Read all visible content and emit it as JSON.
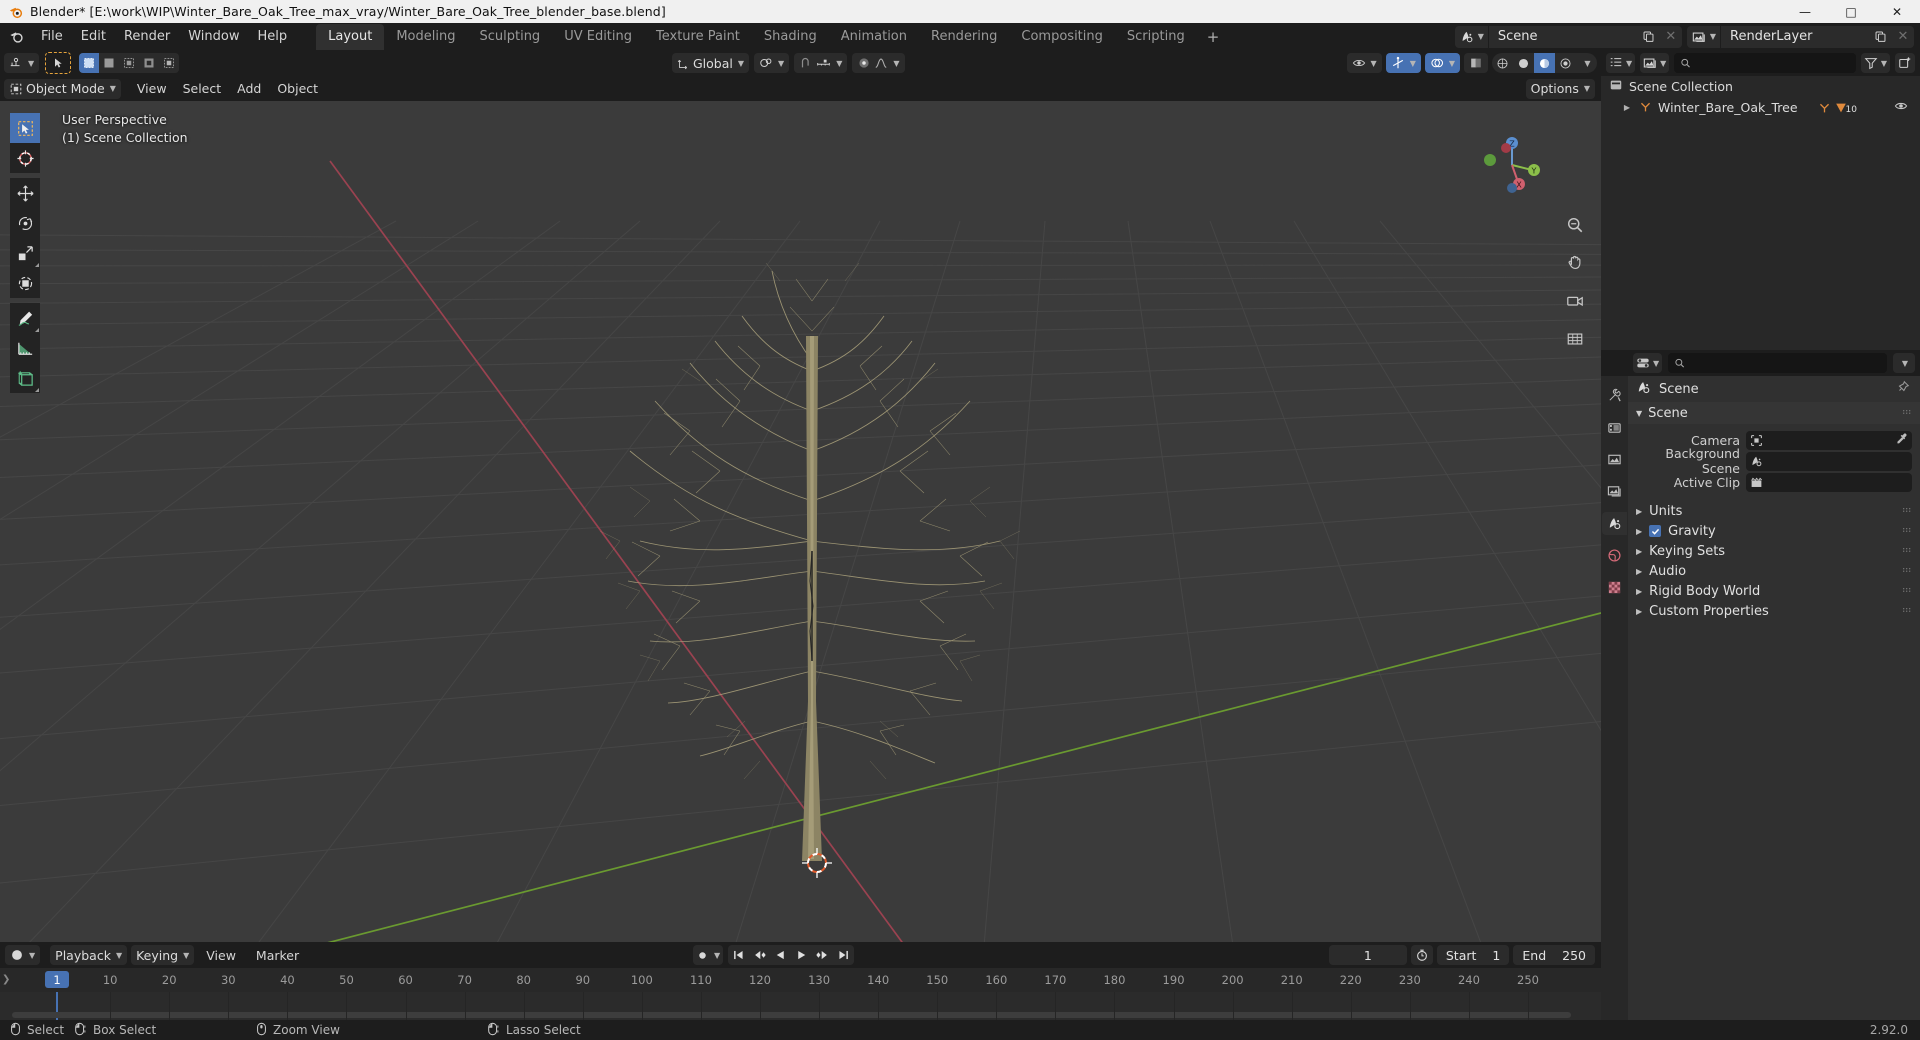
{
  "window": {
    "title": "Blender* [E:\\work\\WIP\\Winter_Bare_Oak_Tree_max_vray/Winter_Bare_Oak_Tree_blender_base.blend]",
    "minimize": "—",
    "maximize": "□",
    "close": "✕"
  },
  "topbar": {
    "menus": [
      "File",
      "Edit",
      "Render",
      "Window",
      "Help"
    ],
    "workspaces": [
      {
        "label": "Layout",
        "active": true
      },
      {
        "label": "Modeling",
        "active": false
      },
      {
        "label": "Sculpting",
        "active": false
      },
      {
        "label": "UV Editing",
        "active": false
      },
      {
        "label": "Texture Paint",
        "active": false
      },
      {
        "label": "Shading",
        "active": false
      },
      {
        "label": "Animation",
        "active": false
      },
      {
        "label": "Rendering",
        "active": false
      },
      {
        "label": "Compositing",
        "active": false
      },
      {
        "label": "Scripting",
        "active": false
      }
    ],
    "add_workspace": "+",
    "scene_name": "Scene",
    "viewlayer_name": "RenderLayer"
  },
  "viewport": {
    "header": {
      "mode": "Object Mode",
      "menus": [
        "View",
        "Select",
        "Add",
        "Object"
      ],
      "transform_orientation": "Global",
      "options_label": "Options"
    },
    "overlay": {
      "view_name": "User Perspective",
      "collection": "(1) Scene Collection"
    },
    "gizmo_axes": {
      "x": "X",
      "y": "Y",
      "z": "Z"
    },
    "tools": [
      "tweak-select-tool",
      "cursor-tool",
      "move-tool",
      "rotate-tool",
      "scale-tool",
      "transform-tool",
      "annotate-tool",
      "measure-tool",
      "add-cube-tool"
    ]
  },
  "outliner": {
    "search_placeholder": "",
    "rows": [
      {
        "label": "Scene Collection",
        "indent": 0,
        "icon": "collection-icon",
        "badge": null
      },
      {
        "label": "Winter_Bare_Oak_Tree",
        "indent": 1,
        "icon": "object-empty-icon",
        "badge": "10"
      }
    ]
  },
  "properties": {
    "search_placeholder": "",
    "breadcrumb": "Scene",
    "panel_title": "Scene",
    "fields": [
      {
        "label": "Camera",
        "value": "",
        "icon": "camera-data-icon",
        "eyedropper": true
      },
      {
        "label": "Background Scene",
        "value": "",
        "icon": "scene-icon",
        "eyedropper": false
      },
      {
        "label": "Active Clip",
        "value": "",
        "icon": "clip-icon",
        "eyedropper": false
      }
    ],
    "closed_panels": [
      {
        "label": "Units",
        "checkbox": null
      },
      {
        "label": "Gravity",
        "checkbox": true
      },
      {
        "label": "Keying Sets",
        "checkbox": null
      },
      {
        "label": "Audio",
        "checkbox": null
      },
      {
        "label": "Rigid Body World",
        "checkbox": null
      },
      {
        "label": "Custom Properties",
        "checkbox": null
      }
    ],
    "tabs": [
      "tool-tab",
      "render-tab",
      "output-tab",
      "view-layer-tab",
      "scene-tab",
      "world-tab",
      "texture-tab"
    ]
  },
  "timeline": {
    "menus": [
      "Playback",
      "Keying",
      "View",
      "Marker"
    ],
    "current_frame": "1",
    "start_label": "Start",
    "start_value": "1",
    "end_label": "End",
    "end_value": "250",
    "ruler_ticks": [
      10,
      20,
      30,
      40,
      50,
      60,
      70,
      80,
      90,
      100,
      110,
      120,
      130,
      140,
      150,
      160,
      170,
      180,
      190,
      200,
      210,
      220,
      230,
      240,
      250
    ],
    "playhead_frame": "1"
  },
  "statusbar": {
    "items": [
      {
        "icon": "mouse-left-icon",
        "label": "Select"
      },
      {
        "icon": "mouse-left-drag-icon",
        "label": "Box Select"
      },
      {
        "icon": "mouse-middle-icon",
        "label": "Zoom View"
      },
      {
        "icon": "mouse-left-drag-icon",
        "label": "Lasso Select"
      }
    ],
    "version": "2.92.0"
  },
  "colors": {
    "accent": "#4772b3",
    "viewport_bg": "#3b3b3b",
    "panel_bg": "#303030",
    "header_bg": "#1d1d1d",
    "axis_x": "#9a4250",
    "axis_y": "#6a9a30",
    "tree": "#a09874"
  }
}
